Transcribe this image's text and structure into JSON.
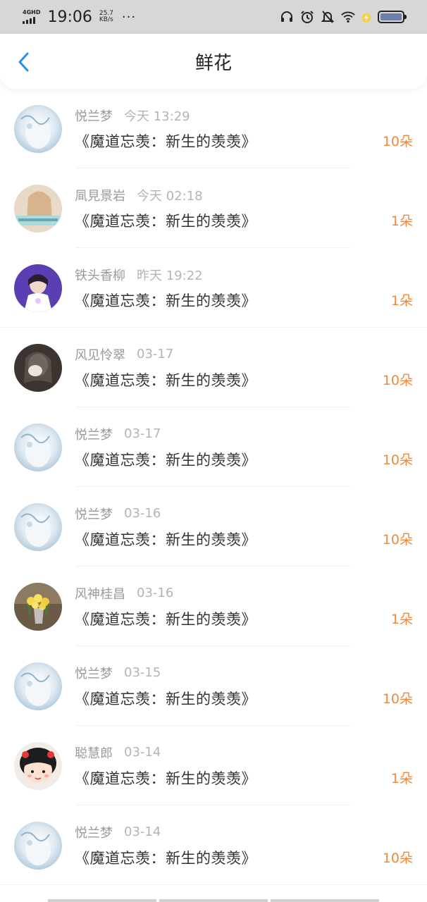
{
  "status_bar": {
    "network": "4GHD",
    "time": "19:06",
    "speed_value": "25.7",
    "speed_unit": "KB/s",
    "more": "···"
  },
  "header": {
    "title": "鲜花"
  },
  "rows": [
    {
      "name": "悦兰梦",
      "time": "今天 13:29",
      "book": "《魔道忘羡：新生的羡羡》",
      "flowers": "10朵"
    },
    {
      "name": "凬見景岩",
      "time": "今天 02:18",
      "book": "《魔道忘羡：新生的羡羡》",
      "flowers": "1朵"
    },
    {
      "name": "铁头香柳",
      "time": "昨天 19:22",
      "book": "《魔道忘羡：新生的羡羡》",
      "flowers": "1朵"
    },
    {
      "name": "风见怜翠",
      "time": "03-17",
      "book": "《魔道忘羡：新生的羡羡》",
      "flowers": "10朵"
    },
    {
      "name": "悦兰梦",
      "time": "03-17",
      "book": "《魔道忘羡：新生的羡羡》",
      "flowers": "10朵"
    },
    {
      "name": "悦兰梦",
      "time": "03-16",
      "book": "《魔道忘羡：新生的羡羡》",
      "flowers": "10朵"
    },
    {
      "name": "风神桂昌",
      "time": "03-16",
      "book": "《魔道忘羡：新生的羡羡》",
      "flowers": "1朵"
    },
    {
      "name": "悦兰梦",
      "time": "03-15",
      "book": "《魔道忘羡：新生的羡羡》",
      "flowers": "10朵"
    },
    {
      "name": "聪慧郎",
      "time": "03-14",
      "book": "《魔道忘羡：新生的羡羡》",
      "flowers": "1朵"
    },
    {
      "name": "悦兰梦",
      "time": "03-14",
      "book": "《魔道忘羡：新生的羡羡》",
      "flowers": "10朵"
    }
  ],
  "colors": {
    "accent_orange": "#f0893a",
    "back_blue": "#2a8fe6"
  }
}
